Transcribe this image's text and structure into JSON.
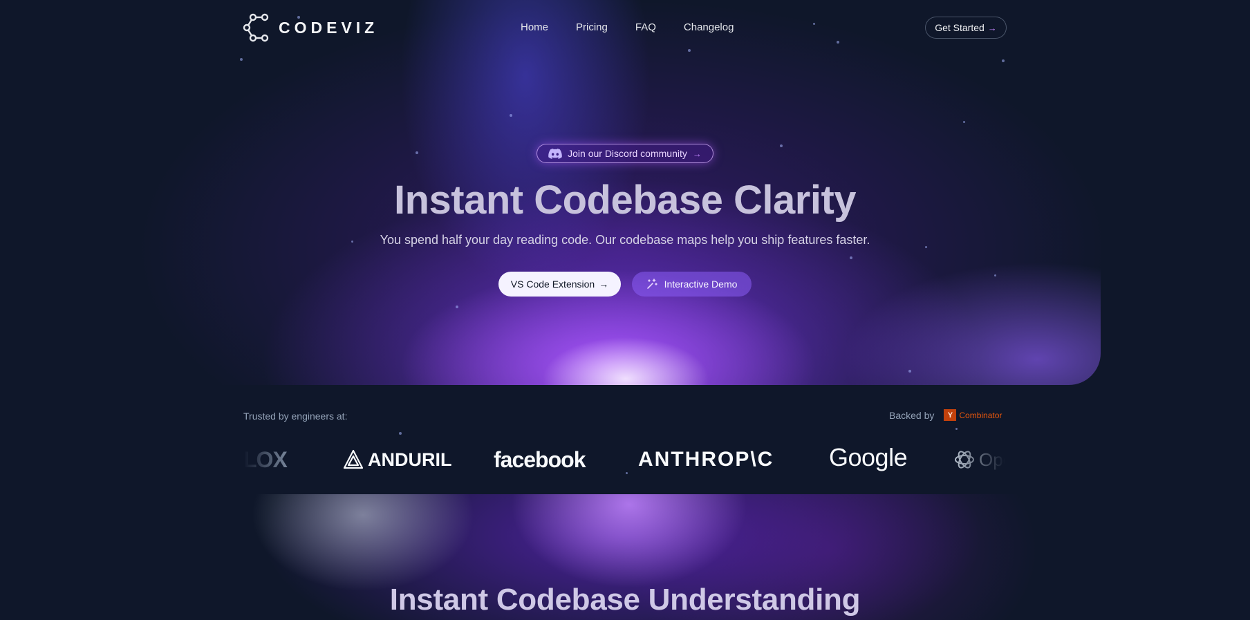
{
  "brand": {
    "name": "CODEVIZ"
  },
  "nav": {
    "links": [
      "Home",
      "Pricing",
      "FAQ",
      "Changelog"
    ],
    "cta_label": "Get Started",
    "cta_arrow": "→"
  },
  "hero": {
    "discord_label": "Join our Discord community",
    "discord_arrow": "→",
    "title": "Instant Codebase Clarity",
    "subtitle": "You spend half your day reading code. Our codebase maps help you ship features faster.",
    "primary_button": "VS Code Extension",
    "primary_arrow": "→",
    "secondary_button": "Interactive Demo"
  },
  "trusted": {
    "label": "Trusted by engineers at:",
    "backed_label": "Backed by",
    "yc_letter": "Y",
    "yc_text": "Combinator",
    "companies": [
      "LOX",
      "ANDURIL",
      "facebook",
      "ANTHROP\\C",
      "Google",
      "OpenAI"
    ]
  },
  "section2": {
    "title": "Instant Codebase Understanding"
  },
  "colors": {
    "background": "#0f172a",
    "accent": "#a855f7",
    "yc_orange": "#ea580c"
  },
  "icons": [
    "codeviz-logo-icon",
    "discord-icon",
    "magic-wand-icon",
    "anduril-logo-icon",
    "openai-logo-icon"
  ]
}
